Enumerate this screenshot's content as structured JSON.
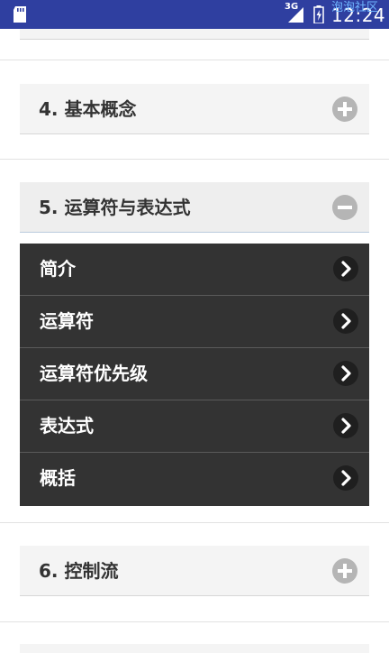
{
  "status_bar": {
    "network": "3G",
    "time": "12:24",
    "watermark": "泡泡社区",
    "icons": [
      "sd-card-icon",
      "signal-icon",
      "battery-icon"
    ]
  },
  "sections": [
    {
      "title": "4. 基本概念",
      "state": "collapsed",
      "icon": "plus-circle-icon"
    },
    {
      "title": "5. 运算符与表达式",
      "state": "expanded",
      "icon": "minus-circle-icon"
    },
    {
      "title": "6. 控制流",
      "state": "collapsed",
      "icon": "plus-circle-icon"
    }
  ],
  "submenu": {
    "items": [
      {
        "label": "简介"
      },
      {
        "label": "运算符"
      },
      {
        "label": "运算符优先级"
      },
      {
        "label": "表达式"
      },
      {
        "label": "概括"
      }
    ],
    "arrow_icon": "chevron-right-icon"
  },
  "colors": {
    "status_bar": "#2f3fa0",
    "card_bg": "#f4f4f4",
    "submenu_bg": "#333333",
    "icon_gray": "#b5b5b5"
  }
}
